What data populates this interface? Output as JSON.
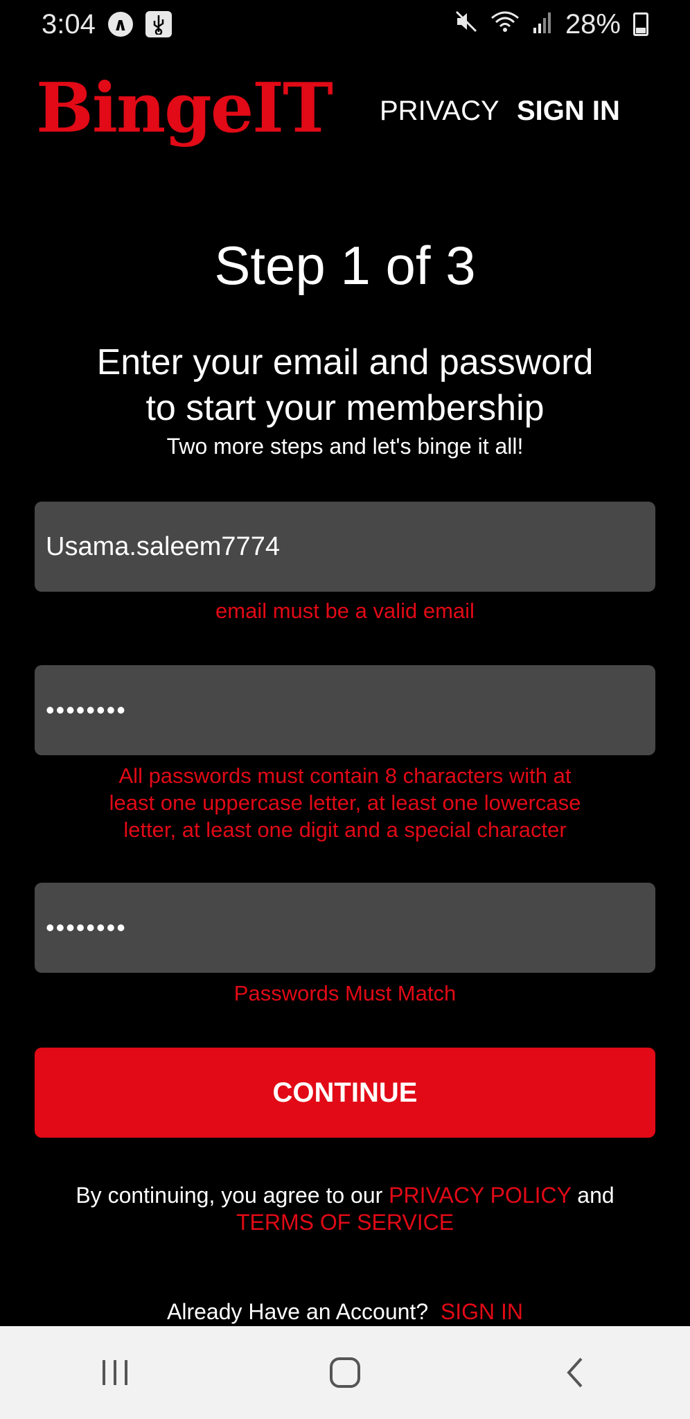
{
  "status_bar": {
    "time": "3:04",
    "battery_percent": "28%",
    "icons": [
      "a-circle-icon",
      "usb-icon",
      "mute-icon",
      "wifi-icon",
      "signal-icon",
      "battery-charging-icon"
    ]
  },
  "header": {
    "logo": "BingeIT",
    "privacy_label": "PRIVACY",
    "signin_label": "SIGN IN"
  },
  "step": {
    "title": "Step 1 of 3",
    "subtitle_line1": "Enter your email and password",
    "subtitle_line2": "to start your membership",
    "hint": "Two more steps and let's binge it all!"
  },
  "form": {
    "email_value": "Usama.saleem7774",
    "email_error": "email must be a valid email",
    "password_value": "••••••••",
    "password_error_line1": "All passwords must contain 8 characters with at",
    "password_error_line2": "least one uppercase letter, at least one lowercase",
    "password_error_line3": "letter, at least one digit and a special character",
    "confirm_value": "••••••••",
    "confirm_error": "Passwords Must Match",
    "continue_label": "CONTINUE"
  },
  "legal": {
    "prefix": "By continuing, you agree to our ",
    "privacy_policy": "PRIVACY POLICY",
    "and": " and",
    "terms_of_service": "TERMS OF SERVICE"
  },
  "footer": {
    "already_text": "Already Have an Account?",
    "signin_link": "SIGN IN"
  },
  "colors": {
    "brand_red": "#e10a16",
    "field_bg": "#484848",
    "background": "#000000",
    "nav_bar_bg": "#f2f2f2"
  }
}
